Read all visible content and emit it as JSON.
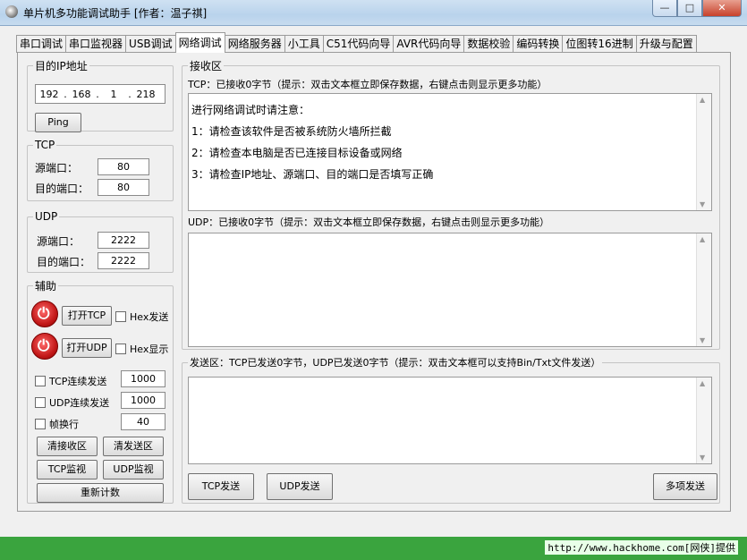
{
  "window": {
    "title": "单片机多功能调试助手 [作者：温子祺]",
    "min_glyph": "—",
    "max_glyph": "□",
    "close_glyph": "✕"
  },
  "tabs": [
    "串口调试",
    "串口监视器",
    "USB调试",
    "网络调试",
    "网络服务器",
    "小工具",
    "C51代码向导",
    "AVR代码向导",
    "数据校验",
    "编码转换",
    "位图转16进制",
    "升级与配置"
  ],
  "active_tab": "网络调试",
  "target": {
    "legend": "目的IP地址",
    "ip": [
      "192",
      "168",
      "1",
      "218"
    ],
    "ping_label": "Ping"
  },
  "tcp": {
    "legend": "TCP",
    "src_label": "源端口：",
    "src_value": "80",
    "dst_label": "目的端口：",
    "dst_value": "80"
  },
  "udp": {
    "legend": "UDP",
    "src_label": "源端口：",
    "src_value": "2222",
    "dst_label": "目的端口：",
    "dst_value": "2222"
  },
  "assist": {
    "legend": "辅助",
    "open_tcp": "打开TCP",
    "hex_send": "Hex发送",
    "open_udp": "打开UDP",
    "hex_show": "Hex显示",
    "tcp_cont": "TCP连续发送",
    "tcp_cont_value": "1000",
    "udp_cont": "UDP连续发送",
    "udp_cont_value": "1000",
    "frame_newline": "帧换行",
    "frame_value": "40",
    "clear_recv": "清接收区",
    "clear_send": "清发送区",
    "tcp_monitor": "TCP监视",
    "udp_monitor": "UDP监视",
    "recount": "重新计数"
  },
  "receive": {
    "legend": "接收区",
    "tcp_header": "TCP：已接收0字节（提示：双击文本框立即保存数据，右键点击则显示更多功能）",
    "notes": [
      "进行网络调试时请注意：",
      "1：请检查该软件是否被系统防火墙所拦截",
      "2：请检查本电脑是否已连接目标设备或网络",
      "3：请检查IP地址、源端口、目的端口是否填写正确"
    ],
    "udp_header": "UDP：已接收0字节（提示：双击文本框立即保存数据，右键点击则显示更多功能）"
  },
  "send": {
    "legend": "发送区：TCP已发送0字节，UDP已发送0字节（提示：双击文本框可以支持Bin/Txt文件发送）",
    "tcp_send": "TCP发送",
    "udp_send": "UDP发送",
    "multi_send": "多项发送"
  },
  "status": {
    "text": "http://www.hackhome.com[网侠]提供"
  },
  "colors": {
    "status_bg": "#3aa43e",
    "power_red": "#c41a1a"
  }
}
